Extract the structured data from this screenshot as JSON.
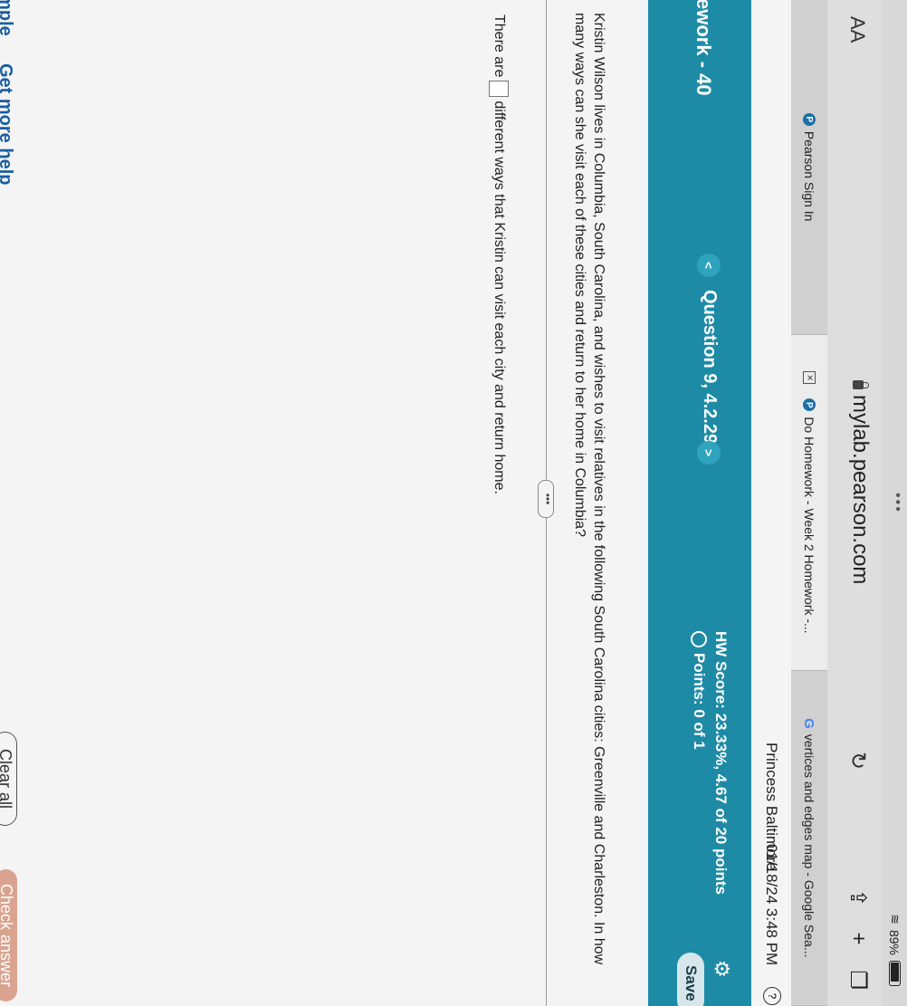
{
  "status": {
    "battery": "89%"
  },
  "browser": {
    "text_size": "AA",
    "url": "mylab.pearson.com"
  },
  "tabs": [
    {
      "label": "Pearson Sign In"
    },
    {
      "label": "Do Homework - Week 2 Homework -..."
    },
    {
      "label": "vertices and edges map - Google Sea..."
    }
  ],
  "user": {
    "name": "Princess Baltimore",
    "datetime": "01/18/24 3:48 PM"
  },
  "header": {
    "title": "ework - 40",
    "question": "Question 9, 4.2.29",
    "score": "HW Score: 23.33%, 4.67 of 20 points",
    "points": "Points: 0 of 1",
    "save": "Save"
  },
  "question": {
    "text": "Kristin Wilson lives in Columbia, South Carolina, and wishes to visit relatives in the following South Carolina cities: Greenville and Charleston. In how many ways can she visit each of these cities and return to her home in Columbia?",
    "answer_prefix": "There are",
    "answer_suffix": "different ways that Kristin can visit each city and return home."
  },
  "footer": {
    "sample": "ample",
    "more_help": "Get more help",
    "clear": "Clear all",
    "check": "Check answer"
  },
  "colors": {
    "header": "#1e8ba6",
    "check_button": "#d9a38f",
    "link": "#1a5ea0"
  }
}
